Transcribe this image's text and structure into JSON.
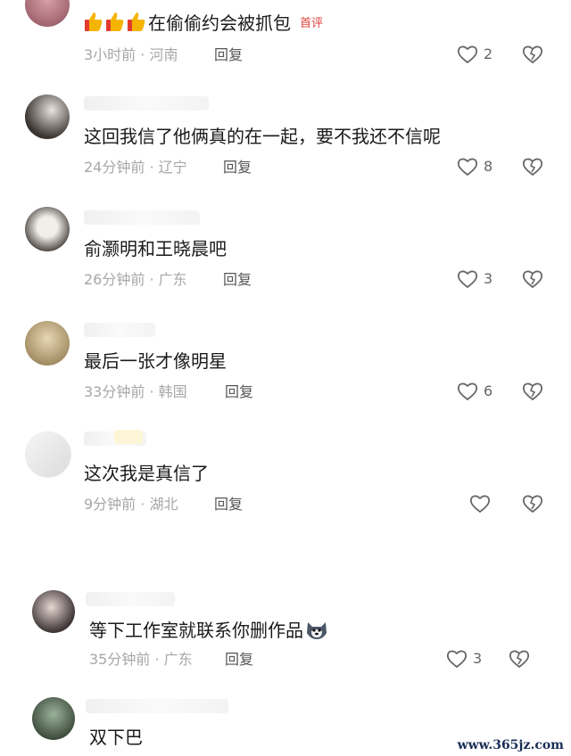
{
  "comments": [
    {
      "text": "在偷偷约会被抓包",
      "badge": "首评",
      "time": "3小时前",
      "location": "河南",
      "reply": "回复",
      "likes": "2"
    },
    {
      "text": "这回我信了他俩真的在一起，要不我还不信呢",
      "time": "24分钟前",
      "location": "辽宁",
      "reply": "回复",
      "likes": "8"
    },
    {
      "text": "俞灏明和王晓晨吧",
      "time": "26分钟前",
      "location": "广东",
      "reply": "回复",
      "likes": "3"
    },
    {
      "text": "最后一张才像明星",
      "time": "33分钟前",
      "location": "韩国",
      "reply": "回复",
      "likes": "6"
    },
    {
      "text": "这次我是真信了",
      "time": "9分钟前",
      "location": "湖北",
      "reply": "回复",
      "likes": ""
    },
    {
      "text": "等下工作室就联系你删作品",
      "time": "35分钟前",
      "location": "广东",
      "reply": "回复",
      "likes": "3"
    },
    {
      "text": "双下巴"
    }
  ],
  "meta_separator": "·",
  "watermark": "www.365jz.com",
  "colors": {
    "accent": "#e0413a",
    "meta": "#a7a7a7"
  },
  "icons": {
    "like": "heart-outline-icon",
    "dislike": "broken-heart-icon",
    "emoji": "thumbs-up-emoji",
    "husky": "husky-emoji"
  }
}
